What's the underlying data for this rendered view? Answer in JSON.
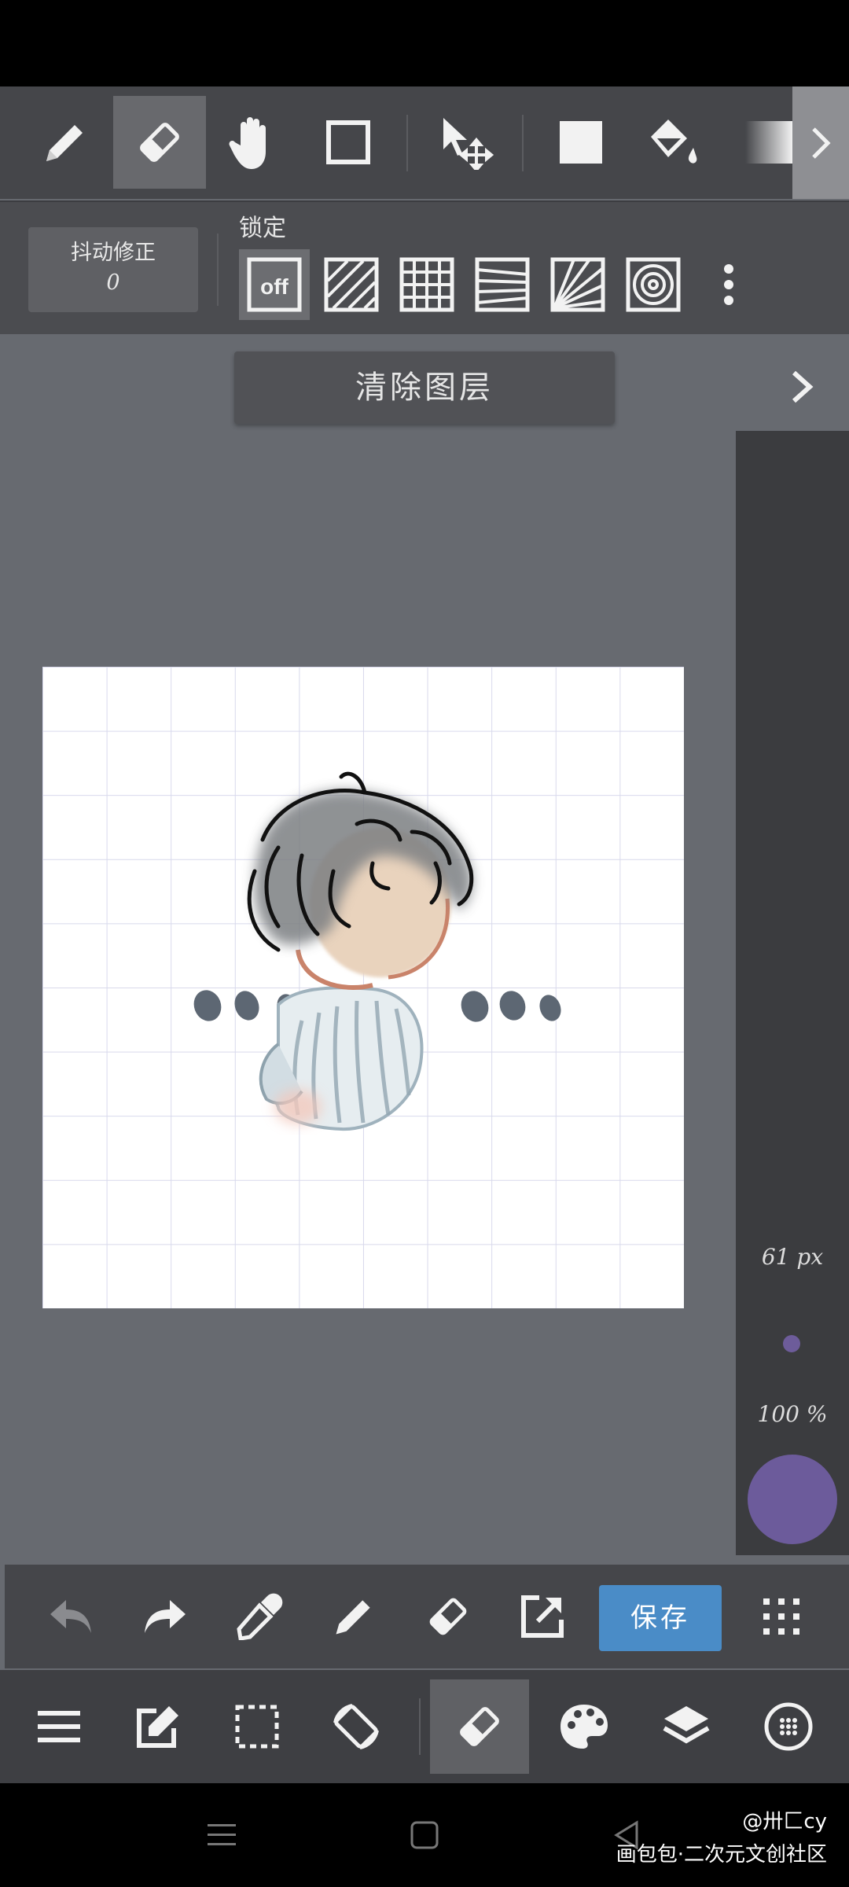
{
  "toolbar": {
    "tools": [
      "pen-icon",
      "eraser-icon",
      "hand-icon",
      "rectangle-icon",
      "move-icon",
      "fill-shape-icon",
      "bucket-icon",
      "gradient-icon"
    ],
    "active_tool": "eraser-icon"
  },
  "stabilizer": {
    "label": "抖动修正",
    "value": "0"
  },
  "lock": {
    "label": "锁定",
    "guides": [
      "off",
      "parallel-lines",
      "grid",
      "perspective-lines",
      "radial-lines",
      "concentric-circles"
    ],
    "off_label": "off"
  },
  "clear_layer": {
    "label": "清除图层"
  },
  "brush": {
    "size_label": "61 px",
    "opacity_label": "100 %",
    "color": "#6c5b9b"
  },
  "actionbar": {
    "items": [
      "undo-icon",
      "redo-icon",
      "eyedropper-icon",
      "pen-icon",
      "eraser-icon",
      "export-icon",
      "save-button",
      "grid-menu-icon"
    ],
    "save_label": "保存"
  },
  "bottomnav": {
    "items": [
      "menu-icon",
      "edit-icon",
      "selection-icon",
      "rotate-icon",
      "eraser-icon",
      "palette-icon",
      "layers-icon",
      "brush-settings-icon"
    ],
    "active": "eraser-icon"
  },
  "watermark": {
    "user": "@卅匚cy",
    "app": "画包包·二次元文创社区"
  },
  "colors": {
    "accent": "#4a8cc7",
    "toolbar_bg": "#45464a",
    "canvas_bg": "#676a70"
  }
}
